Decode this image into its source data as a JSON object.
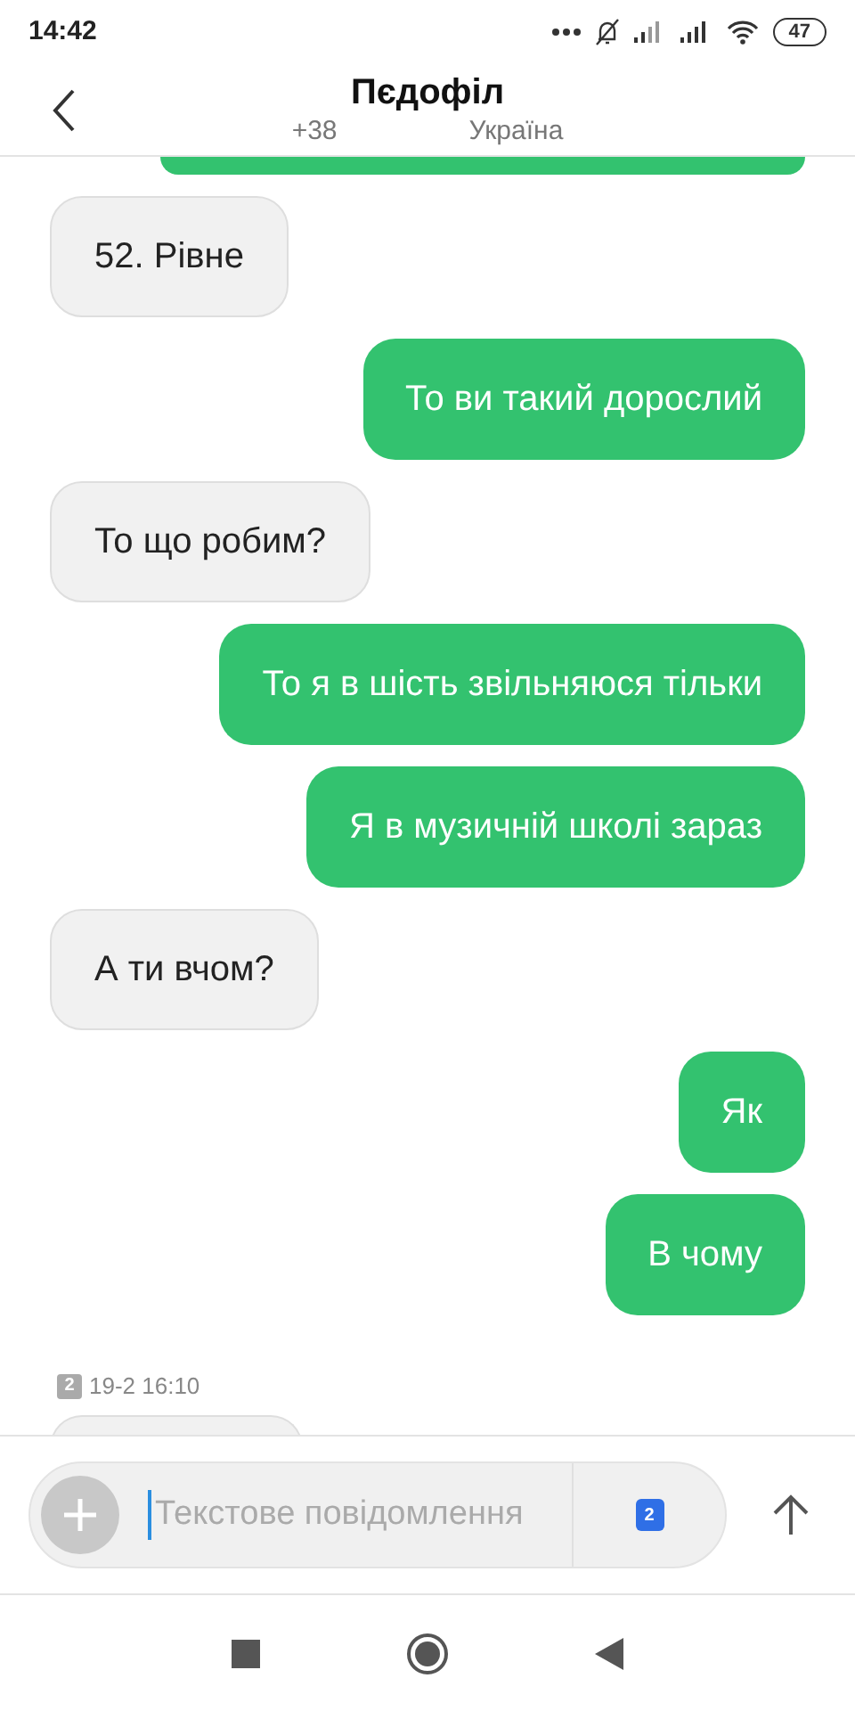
{
  "status_bar": {
    "time": "14:42",
    "battery": "47"
  },
  "header": {
    "title": "Пєдофіл",
    "phone": "+38",
    "country": "Україна"
  },
  "messages": [
    {
      "kind": "incoming",
      "text": "52. Рівне"
    },
    {
      "kind": "outgoing",
      "text": "То ви такий дорослий"
    },
    {
      "kind": "incoming",
      "text": "То що робим?"
    },
    {
      "kind": "outgoing",
      "text": "То я в шість звільняюся тільки"
    },
    {
      "kind": "outgoing",
      "text": "Я в музичній школі зараз"
    },
    {
      "kind": "incoming",
      "text": "А ти вчом?"
    },
    {
      "kind": "outgoing",
      "text": "Як"
    },
    {
      "kind": "outgoing",
      "text": "В чому"
    }
  ],
  "timestamp": {
    "sim": "2",
    "time": "19-2 16:10"
  },
  "composer": {
    "placeholder": "Текстове повідомлення",
    "sim": "2"
  }
}
